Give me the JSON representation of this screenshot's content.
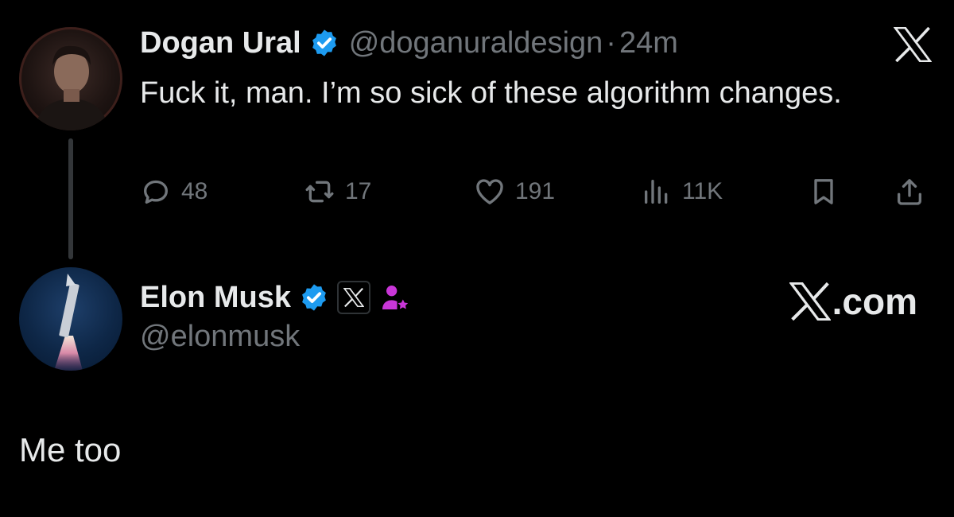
{
  "original_tweet": {
    "display_name": "Dogan Ural",
    "handle": "@doganuraldesign",
    "separator": "·",
    "time": "24m",
    "text": "Fuck it, man. I’m so sick of these algorithm changes.",
    "avatar_icon": "user-photo-avatar",
    "verified_icon": "verified-badge-icon",
    "stats": {
      "replies": "48",
      "reposts": "17",
      "likes": "191",
      "views": "11K"
    },
    "platform_icon": "x-logo-icon"
  },
  "reply_profile": {
    "display_name": "Elon Musk",
    "handle": "@elonmusk",
    "avatar_icon": "rocket-avatar",
    "verified_icon": "verified-badge-icon",
    "affiliation_icon": "x-affiliate-badge-icon",
    "extra_icon": "affiliate-user-star-icon",
    "brand_text": ".com",
    "reply_text": "Me too"
  },
  "colors": {
    "background": "#000000",
    "primary_text": "#e7e9ea",
    "secondary_text": "#71767b",
    "verified_blue": "#1d9bf0",
    "affiliate_purple": "#c936d8",
    "thread_line": "#333639"
  }
}
